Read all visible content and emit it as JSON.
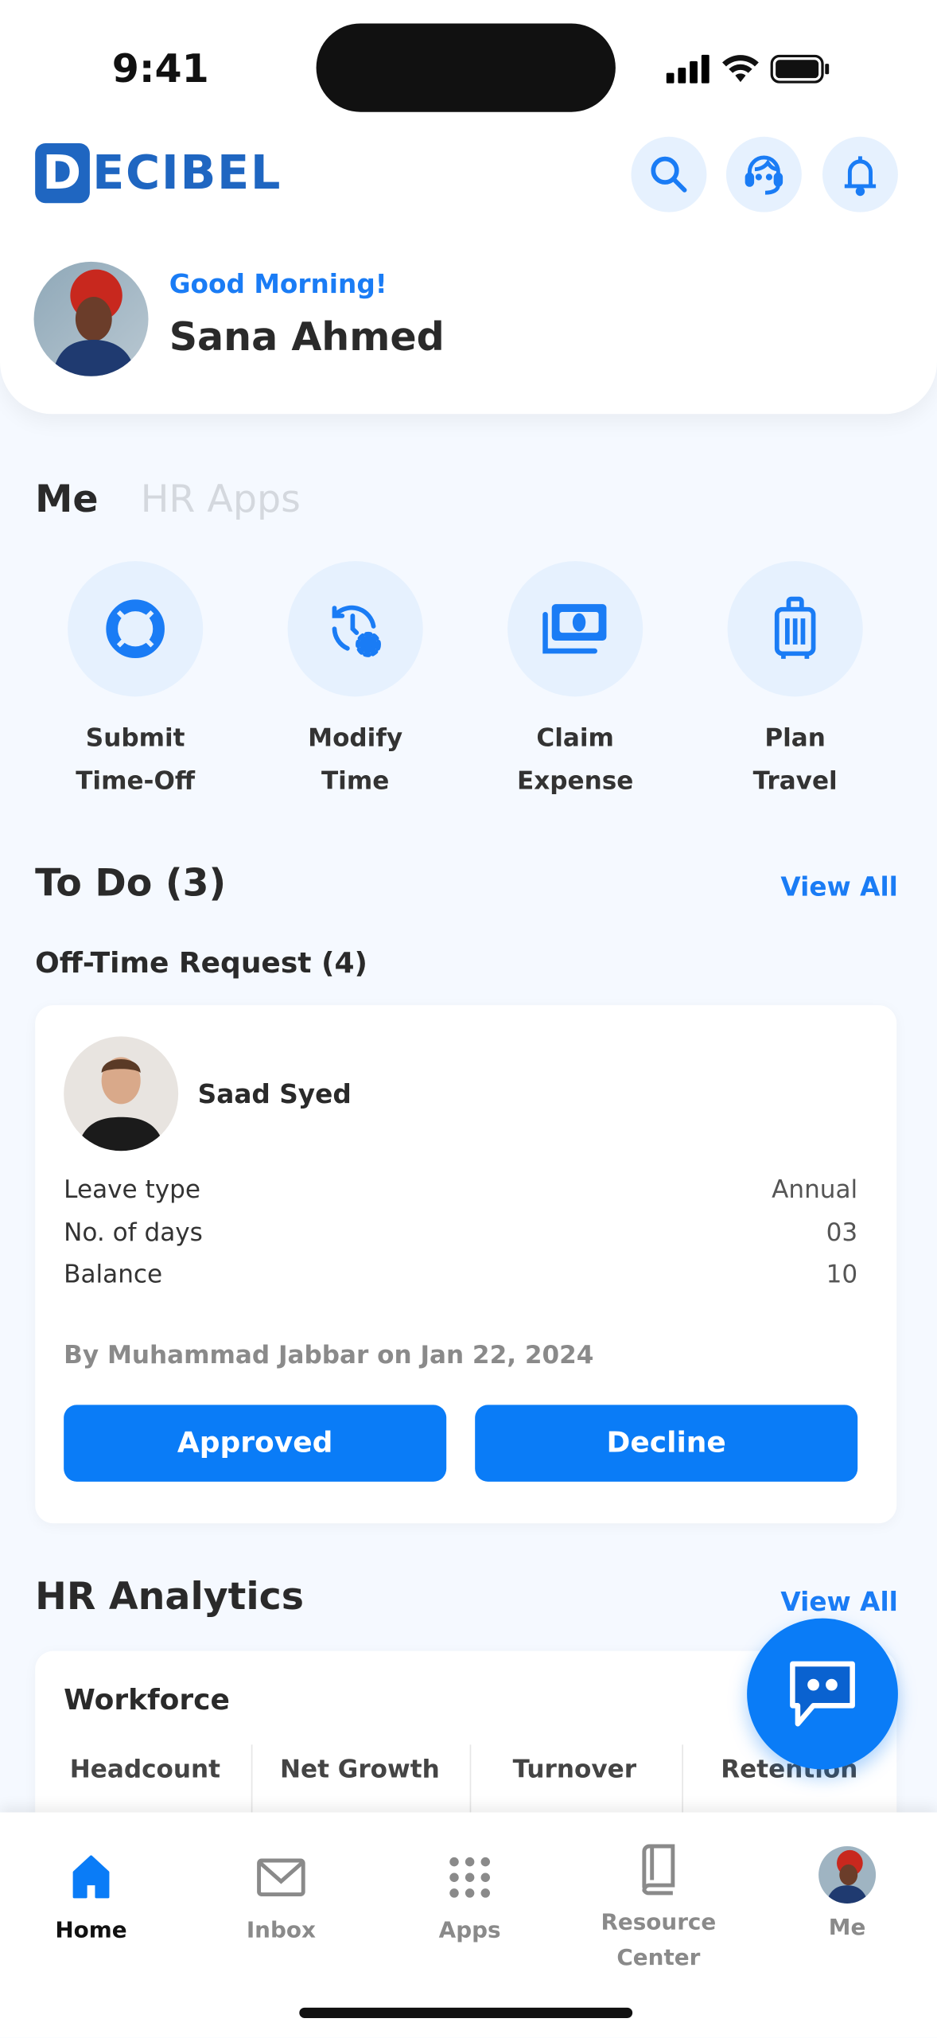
{
  "status_bar": {
    "time": "9:41"
  },
  "header": {
    "brand": "DECIBEL",
    "brand_initial": "D",
    "brand_rest": "ECIBEL",
    "brand_color": "#1f66c1",
    "icons": [
      "search-icon",
      "headset-icon",
      "bell-icon"
    ],
    "greeting": "Good Morning!",
    "user_name": "Sana Ahmed"
  },
  "tabs": [
    {
      "label": "Me",
      "active": true
    },
    {
      "label": "HR Apps",
      "active": false
    }
  ],
  "quick_actions": [
    {
      "line1": "Submit",
      "line2": "Time-Off",
      "icon": "lifebuoy-icon"
    },
    {
      "line1": "Modify",
      "line2": "Time",
      "icon": "clock-settings-icon"
    },
    {
      "line1": "Claim",
      "line2": "Expense",
      "icon": "money-icon"
    },
    {
      "line1": "Plan",
      "line2": "Travel",
      "icon": "luggage-icon"
    }
  ],
  "todo": {
    "title": "To Do (3)",
    "view_all": "View All",
    "subtitle": "Off-Time Request (4)",
    "request": {
      "name": "Saad Syed",
      "rows": [
        {
          "label": "Leave type",
          "value": "Annual"
        },
        {
          "label": "No. of days",
          "value": "03"
        },
        {
          "label": "Balance",
          "value": "10"
        }
      ],
      "by_line": "By Muhammad Jabbar on Jan 22, 2024",
      "approve_label": "Approved",
      "decline_label": "Decline"
    }
  },
  "analytics": {
    "title": "HR Analytics",
    "view_all": "View All",
    "card_title": "Workforce",
    "columns": [
      "Headcount",
      "Net Growth",
      "Turnover",
      "Retention"
    ]
  },
  "bottom_nav": [
    {
      "label": "Home",
      "active": true
    },
    {
      "label": "Inbox"
    },
    {
      "label": "Apps"
    },
    {
      "label": "Resource Center"
    },
    {
      "label": "Me"
    }
  ],
  "colors": {
    "accent": "#0a7cf7",
    "icon_bg": "#e6f1fe",
    "background": "#f5f9ff"
  }
}
